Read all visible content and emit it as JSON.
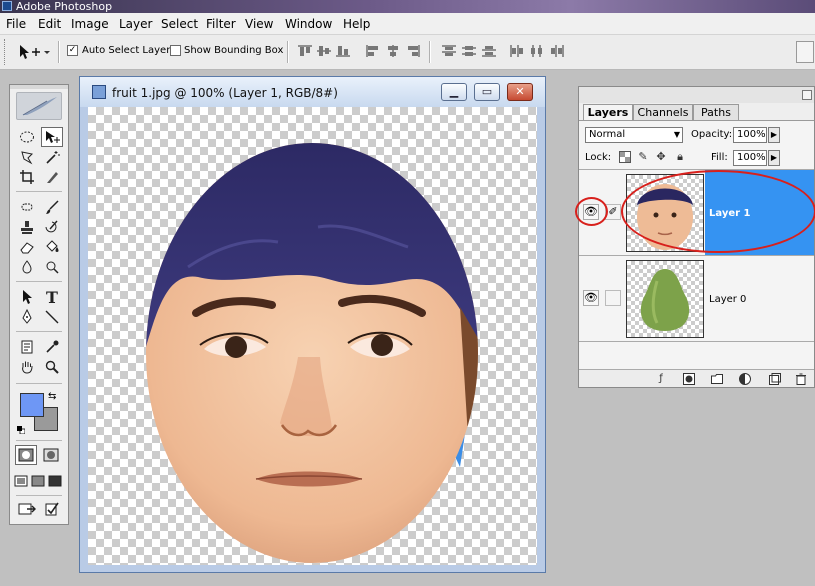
{
  "app": {
    "title": "Adobe Photoshop"
  },
  "menu": [
    "File",
    "Edit",
    "Image",
    "Layer",
    "Select",
    "Filter",
    "View",
    "Window",
    "Help"
  ],
  "options_bar": {
    "auto_select_layer": {
      "label": "Auto Select Layer",
      "checked": true
    },
    "show_bounding_box": {
      "label": "Show Bounding Box",
      "checked": false
    }
  },
  "document": {
    "title": "fruit 1.jpg @ 100% (Layer 1, RGB/8#)"
  },
  "toolbox": {
    "foreground_color": "#6e97f5",
    "background_color": "#9a9a9a"
  },
  "layers_panel": {
    "tabs": [
      "Layers",
      "Channels",
      "Paths"
    ],
    "active_tab": "Layers",
    "blend_mode": "Normal",
    "opacity_label": "Opacity:",
    "opacity": "100%",
    "lock_label": "Lock:",
    "fill_label": "Fill:",
    "fill": "100%",
    "layers": [
      {
        "name": "Layer 1",
        "selected": true,
        "visible": true,
        "thumbnail": "face-thumbnail"
      },
      {
        "name": "Layer 0",
        "selected": false,
        "visible": true,
        "thumbnail": "guava-thumbnail"
      }
    ]
  },
  "annotations": {
    "highlight_color": "#d8201c"
  }
}
